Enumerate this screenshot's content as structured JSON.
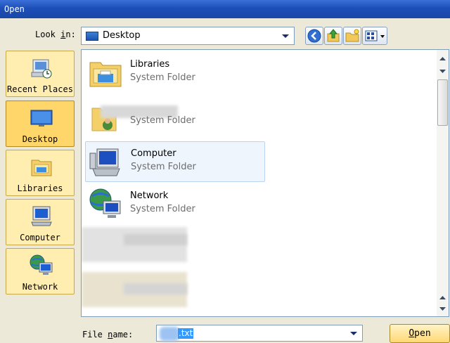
{
  "window": {
    "title": "Open"
  },
  "look_in": {
    "label_prefix": "Look ",
    "label_accel": "i",
    "label_suffix": "n:",
    "value": "Desktop"
  },
  "places": [
    {
      "label": "Recent Places",
      "icon": "recent-places-icon"
    },
    {
      "label": "Desktop",
      "icon": "desktop-icon",
      "selected": true
    },
    {
      "label": "Libraries",
      "icon": "libraries-icon"
    },
    {
      "label": "Computer",
      "icon": "computer-icon"
    },
    {
      "label": "Network",
      "icon": "network-icon"
    }
  ],
  "files": [
    {
      "name": "Libraries",
      "type": "System Folder",
      "icon": "libraries-folder-icon"
    },
    {
      "name": "",
      "type": "System Folder",
      "icon": "user-folder-icon"
    },
    {
      "name": "Computer",
      "type": "System Folder",
      "icon": "computer-icon",
      "selected": true
    },
    {
      "name": "Network",
      "type": "System Folder",
      "icon": "network-icon"
    }
  ],
  "file_name": {
    "label_prefix": "File ",
    "label_accel": "n",
    "label_suffix": "ame:",
    "value": ".txt"
  },
  "buttons": {
    "open_accel": "O",
    "open_rest": "pen"
  },
  "colors": {
    "titlebar": "#1d4fb8",
    "selected_place": "#ffd66a",
    "place": "#ffeeb0",
    "selection": "#3399ff"
  }
}
